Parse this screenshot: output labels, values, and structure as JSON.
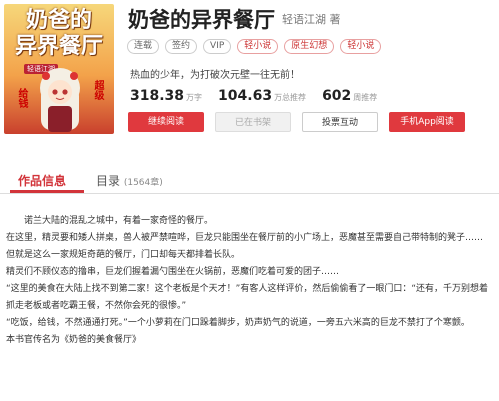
{
  "book": {
    "title": "奶爸的异界餐厅",
    "author": "轻语江湖 著",
    "tags": [
      "连载",
      "签约",
      "VIP",
      "轻小说",
      "原生幻想",
      "轻小说"
    ],
    "intro": "热血的少年，为打破次元壁一往无前！",
    "stats": [
      {
        "value": "318.38",
        "unit": "万字"
      },
      {
        "value": "104.63",
        "unit": "万总推荐"
      },
      {
        "value": "602",
        "unit": "周推荐"
      }
    ],
    "buttons": {
      "read": "继续阅读",
      "shelf": "已在书架",
      "vote": "投票互动",
      "app": "手机App阅读"
    }
  },
  "cover": {
    "title_line1": "奶爸的",
    "title_line2": "异界餐厅",
    "author": "轻语江湖",
    "side_left": "给钱",
    "side_right": "超级"
  },
  "tabs": {
    "info": "作品信息",
    "catalog": "目录",
    "catalog_count": "(1564章)"
  },
  "content": [
    "诺兰大陆的混乱之城中，有着一家奇怪的餐厅。",
    "在这里，精灵要和矮人拼桌，兽人被严禁喧哗，巨龙只能围坐在餐厅前的小广场上，恶魔甚至需要自己带特制的凳子……",
    "但就是这么一家规矩奇葩的餐厅，门口却每天都排着长队。",
    "精灵们不顾仪态的撸串，巨龙们握着漏勺围坐在火锅前，恶魔们吃着可爱的团子……",
    "“这里的美食在大陆上找不到第二家！这个老板是个天才！”有客人这样评价，然后偷偷看了一眼门口：“还有，千万别想着抓走老板或者吃霸王餐，不然你会死的很惨。”",
    "“吃饭，给钱，不然通通打死。”一个小萝莉在门口跺着脚步，奶声奶气的说道，一旁五六米高的巨龙不禁打了个寒颤。",
    "本书官传名为《奶爸的美食餐厅》"
  ],
  "colors": {
    "accent": "#d2343a",
    "button_red": "#e0393e"
  }
}
